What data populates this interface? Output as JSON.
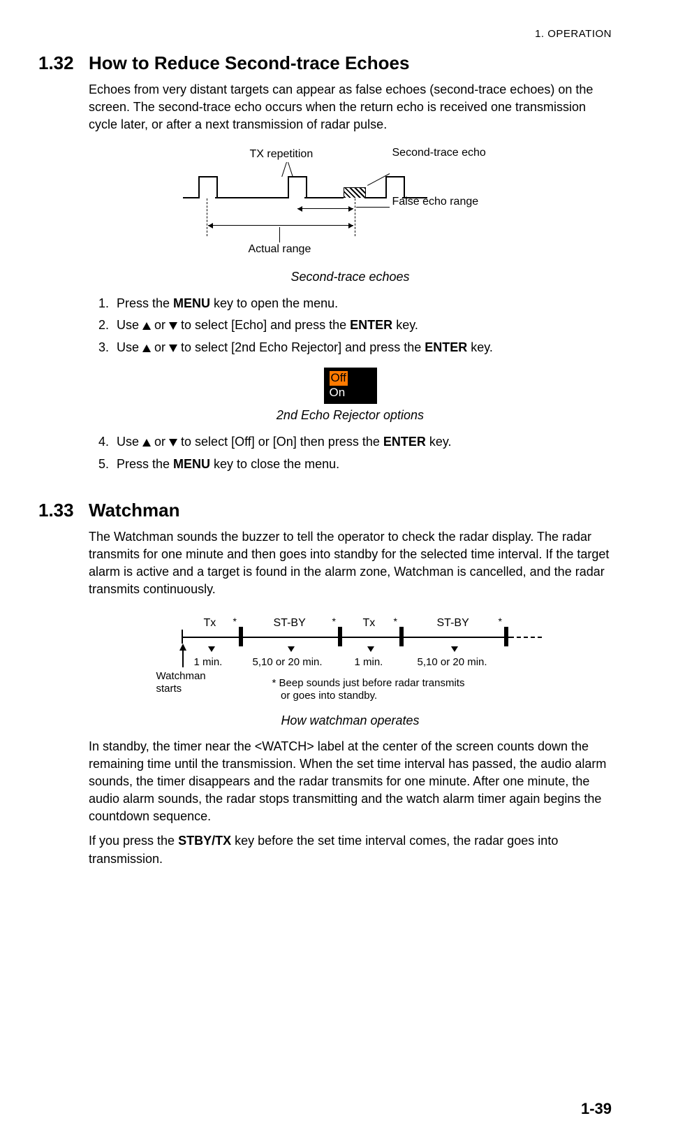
{
  "running_head": "1.  OPERATION",
  "page_number": "1-39",
  "s132": {
    "num": "1.32",
    "title": "How to Reduce Second-trace Echoes",
    "para1": "Echoes from very distant targets can appear as false echoes (second-trace echoes) on the screen. The second-trace echo occurs when the return echo is received one transmission cycle later, or after a next transmission of radar pulse.",
    "fig1": {
      "tx_rep": "TX repetition",
      "second_echo": "Second-trace echo",
      "false_range": "False echo range",
      "actual_range": "Actual range",
      "caption": "Second-trace echoes"
    },
    "step1_a": "Press the ",
    "step1_b": " key to open the menu.",
    "menu_key": "MENU",
    "step2_a": "Use ",
    "step2_or": " or ",
    "step2_b": " to select [Echo] and press the ",
    "enter_key": "ENTER",
    "step2_c": " key.",
    "step3_b": " to select [2nd Echo Rejector] and press the ",
    "opt_off": "Off",
    "opt_on": "On",
    "fig2_caption": "2nd Echo Rejector options",
    "step4_b": " to select [Off] or [On] then press the ",
    "step5_a": "Press the ",
    "step5_b": " key to close the menu."
  },
  "s133": {
    "num": "1.33",
    "title": "Watchman",
    "para1": "The Watchman sounds the buzzer to tell the operator to check the radar display. The radar transmits for one minute and then goes into standby for the selected time interval. If the target alarm is active and a target is found in the alarm zone, Watchman is cancelled, and the radar transmits continuously.",
    "fig": {
      "tx": "Tx",
      "stby": "ST-BY",
      "one_min": "1 min.",
      "interval": "5,10 or 20 min.",
      "starts": "Watchman\nstarts",
      "note": "* Beep sounds just before radar transmits\n   or goes into standby.",
      "caption": "How watchman operates"
    },
    "para2": "In standby, the timer near the <WATCH> label at the center of the screen counts down the remaining time until the transmission. When the set time interval has passed, the audio alarm sounds, the timer disappears and the radar transmits for one minute. After one minute, the audio alarm sounds, the radar stops transmitting and the watch alarm timer again begins the countdown sequence.",
    "para3_a": "If you press the ",
    "stby_key": "STBY/TX",
    "para3_b": " key before the set time interval comes, the radar goes into transmission."
  }
}
